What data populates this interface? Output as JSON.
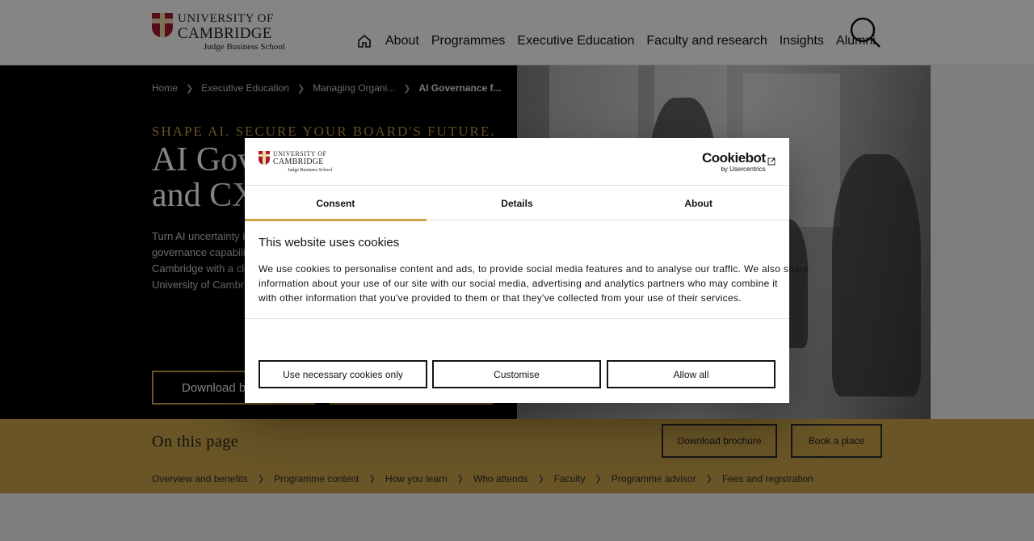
{
  "header": {
    "logo": {
      "line1": "UNIVERSITY OF",
      "line2": "CAMBRIDGE",
      "line3": "Judge Business School"
    },
    "nav": [
      "About",
      "Programmes",
      "Executive Education",
      "Faculty and research",
      "Insights",
      "Alumni"
    ]
  },
  "breadcrumb": [
    "Home",
    "Executive Education",
    "Managing Organi...",
    "AI Governance f..."
  ],
  "hero": {
    "kicker": "SHAPE AI. SECURE YOUR BOARD'S FUTURE.",
    "title_line1": "AI Gov",
    "title_line2": "and CX",
    "desc": [
      "Turn AI uncertainty in",
      "governance capabiliti",
      "Cambridge with a cle",
      "University of Cambrid"
    ],
    "btn1": "Download b"
  },
  "on_this_page": {
    "title": "On this page",
    "download_label": "Download brochure",
    "book_label": "Book a place",
    "links": [
      "Overview and benefits",
      "Programme content",
      "How you learn",
      "Who attends",
      "Faculty",
      "Programme advisor",
      "Fees and registration"
    ]
  },
  "cookie_dialog": {
    "logo": {
      "line1": "UNIVERSITY OF",
      "line2": "CAMBRIDGE",
      "line3": "Judge Business School"
    },
    "brand_main": "Cookiebot",
    "brand_sub": "by Usercentrics",
    "tabs": [
      "Consent",
      "Details",
      "About"
    ],
    "title": "This website uses cookies",
    "text": [
      "We use cookies to personalise content and ads, to provide social media features and to analyse our traffic. We also share",
      "information about your use of our site with our social media, advertising and analytics partners who may combine it",
      "with other information that you've provided to them or that they've collected from your use of their services."
    ],
    "btn_necessary": "Use necessary cookies only",
    "btn_customise": "Customise",
    "btn_allow": "Allow all"
  },
  "colors": {
    "gold": "#c9a44a",
    "crest": "#a6192e"
  }
}
